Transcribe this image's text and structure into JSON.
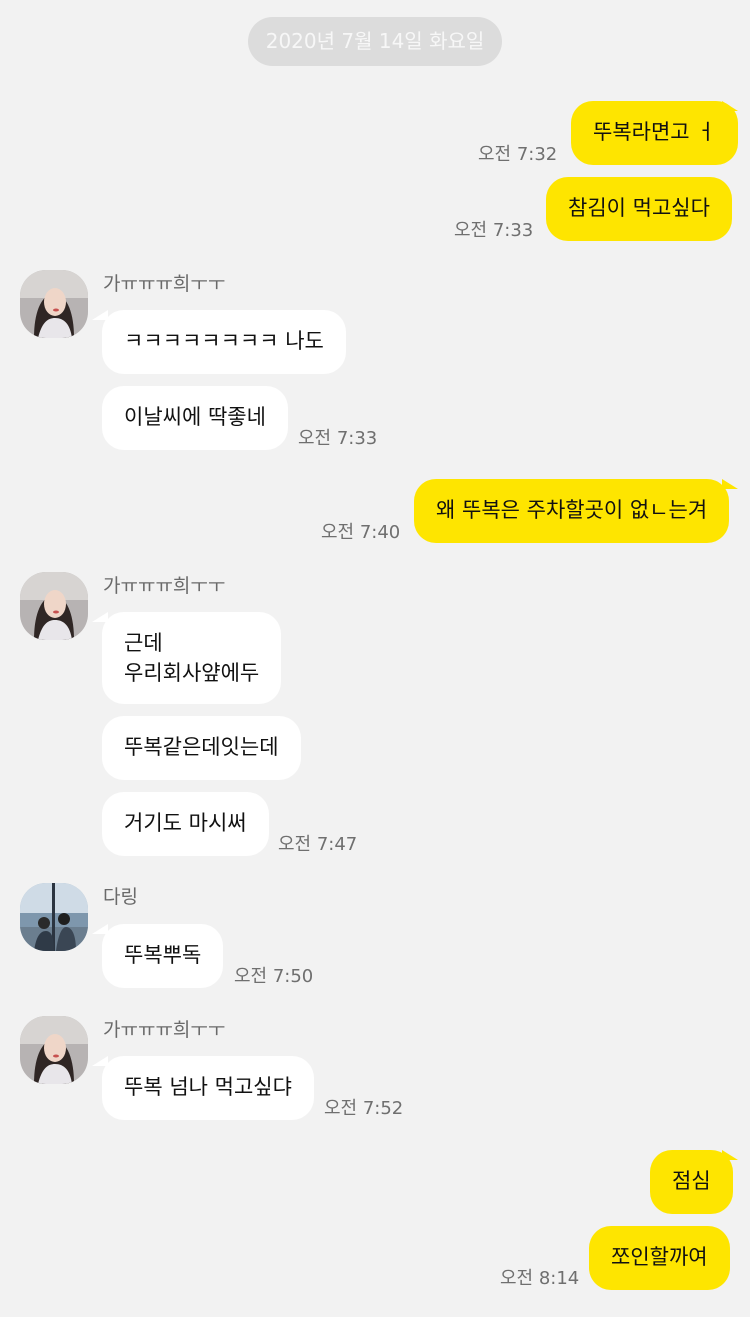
{
  "date_divider": "2020년 7월 14일 화요일",
  "colors": {
    "background": "#f2f2f2",
    "my_bubble": "#fee500",
    "their_bubble": "#ffffff",
    "date_pill": "#dcdcdc"
  },
  "messages": [
    {
      "sender": "me",
      "text": "뚜복라면고 ㅓ",
      "time": "오전 7:32"
    },
    {
      "sender": "me",
      "text": "참김이 먹고싶다",
      "time": "오전 7:33"
    },
    {
      "sender": "가ㅠㅠㅠ희ㅜㅜ",
      "text": "ㅋㅋㅋㅋㅋㅋㅋㅋ 나도"
    },
    {
      "sender": "가ㅠㅠㅠ희ㅜㅜ",
      "text": "이날씨에 딱좋네",
      "time": "오전 7:33"
    },
    {
      "sender": "me",
      "text": "왜 뚜복은 주차할곳이 없ㄴ는겨",
      "time": "오전 7:40"
    },
    {
      "sender": "가ㅠㅠㅠ희ㅜㅜ",
      "text": "근데\n우리회사얖에두"
    },
    {
      "sender": "가ㅠㅠㅠ희ㅜㅜ",
      "text": "뚜복같은데잇는데"
    },
    {
      "sender": "가ㅠㅠㅠ희ㅜㅜ",
      "text": "거기도 마시써",
      "time": "오전 7:47"
    },
    {
      "sender": "다링",
      "text": "뚜복뿌독",
      "time": "오전 7:50"
    },
    {
      "sender": "가ㅠㅠㅠ희ㅜㅜ",
      "text": "뚜복 넘나 먹고싶댜",
      "time": "오전 7:52"
    },
    {
      "sender": "me",
      "text": "점심"
    },
    {
      "sender": "me",
      "text": "쪼인할까여",
      "time": "오전 8:14"
    }
  ],
  "senders": {
    "a": "가ㅠㅠㅠ희ㅜㅜ",
    "b": "다링"
  }
}
